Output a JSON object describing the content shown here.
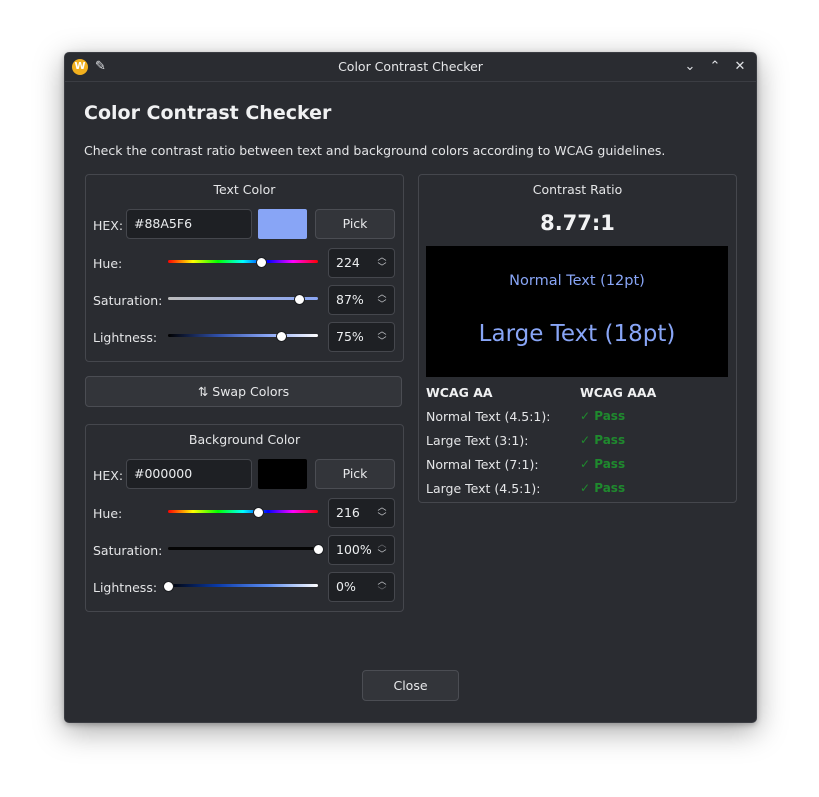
{
  "window": {
    "app_icon": "W",
    "title": "Color Contrast Checker",
    "controls": {
      "minimize": "⌄",
      "maximize": "⌃",
      "close": "✕"
    },
    "pin_icon": "✎"
  },
  "heading": "Color Contrast Checker",
  "description": "Check the contrast ratio between text and background colors according to WCAG guidelines.",
  "text_color": {
    "title": "Text Color",
    "hex_label": "HEX:",
    "hex_value": "#88A5F6",
    "swatch_color": "#88A5F6",
    "pick_label": "Pick",
    "hue_label": "Hue:",
    "hue_value": "224",
    "hue_position": 0.622,
    "saturation_label": "Saturation:",
    "saturation_value": "87%",
    "saturation_position": 0.87,
    "lightness_label": "Lightness:",
    "lightness_value": "75%",
    "lightness_position": 0.75
  },
  "swap_label": "⇅ Swap Colors",
  "background_color": {
    "title": "Background Color",
    "hex_label": "HEX:",
    "hex_value": "#000000",
    "swatch_color": "#000000",
    "pick_label": "Pick",
    "hue_label": "Hue:",
    "hue_value": "216",
    "hue_position": 0.6,
    "saturation_label": "Saturation:",
    "saturation_value": "100%",
    "saturation_position": 1.0,
    "lightness_label": "Lightness:",
    "lightness_value": "0%",
    "lightness_position": 0.0
  },
  "contrast": {
    "title": "Contrast Ratio",
    "ratio": "8.77:1",
    "preview_normal": "Normal Text (12pt)",
    "preview_large": "Large Text (18pt)",
    "preview_text_color": "#88A5F6",
    "preview_bg_color": "#000000",
    "aa_header": "WCAG AA",
    "aaa_header": "WCAG AAA",
    "rows": [
      {
        "label": "Normal Text (4.5:1):",
        "result": "✓ Pass"
      },
      {
        "label": "Large Text (3:1):",
        "result": "✓ Pass"
      },
      {
        "label": "Normal Text (7:1):",
        "result": "✓ Pass"
      },
      {
        "label": "Large Text (4.5:1):",
        "result": "✓ Pass"
      }
    ],
    "pass_color": "#1f8a2e"
  },
  "close_label": "Close"
}
